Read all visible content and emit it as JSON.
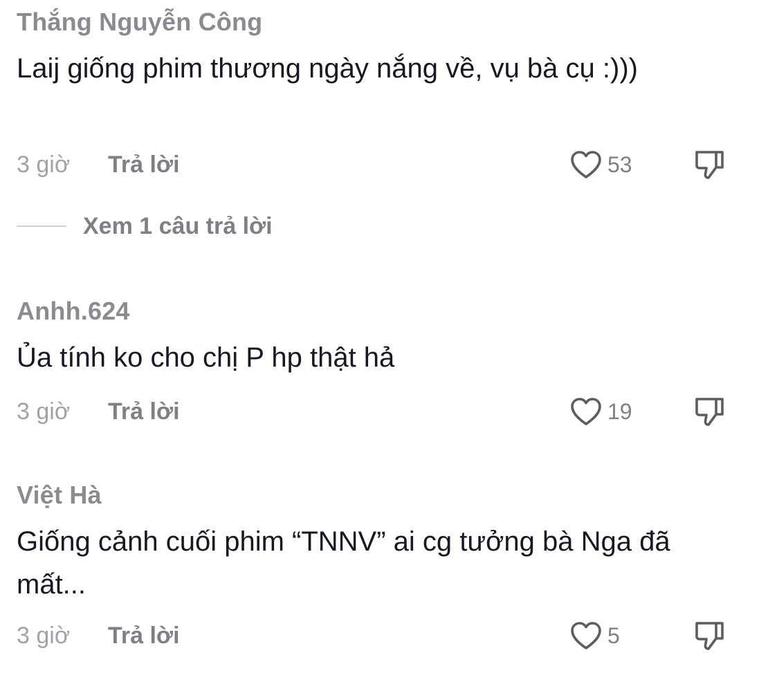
{
  "comments": [
    {
      "username": "Thắng Nguyễn Công",
      "text": "Laij giống phim thương ngày nắng về, vụ bà cụ :)))",
      "time": "3 giờ",
      "reply_label": "Trả lời",
      "likes": "53",
      "view_replies": "Xem 1 câu trả lời"
    },
    {
      "username": "Anhh.624",
      "text": "Ủa tính ko cho chị P hp thật hả",
      "time": "3 giờ",
      "reply_label": "Trả lời",
      "likes": "19"
    },
    {
      "username": "Việt Hà",
      "text": "Giống cảnh cuối phim “TNNV” ai cg tưởng bà Nga đã mất...",
      "time": "3 giờ",
      "reply_label": "Trả lời",
      "likes": "5"
    }
  ],
  "icons": {
    "like": "heart-outline-icon",
    "dislike": "thumbs-down-icon"
  },
  "colors": {
    "username": "#8a8b91",
    "text": "#161823",
    "meta": "#a1a2a7"
  }
}
